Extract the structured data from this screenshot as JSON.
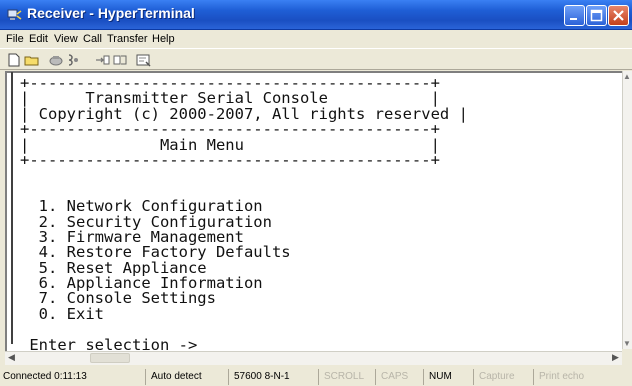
{
  "window": {
    "title": "Receiver - HyperTerminal"
  },
  "menu": [
    "File",
    "Edit",
    "View",
    "Call",
    "Transfer",
    "Help"
  ],
  "toolbar": {
    "icons": [
      "new-connection-icon",
      "open-icon",
      "call-icon",
      "disconnect-icon",
      "send-icon",
      "receive-icon",
      "properties-icon"
    ]
  },
  "terminal": {
    "lines": [
      "+-------------------------------------------+",
      "|      Transmitter Serial Console           |",
      "| Copyright (c) 2000-2007, All rights reserved |",
      "+-------------------------------------------+",
      "|              Main Menu                    |",
      "+-------------------------------------------+",
      "",
      "",
      "  1. Network Configuration",
      "  2. Security Configuration",
      "  3. Firmware Management",
      "  4. Restore Factory Defaults",
      "  5. Reset Appliance",
      "  6. Appliance Information",
      "  7. Console Settings",
      "  0. Exit",
      "",
      " Enter selection -> _"
    ]
  },
  "status": {
    "connected": "Connected 0:11:13",
    "detect": "Auto detect",
    "port": "57600 8-N-1",
    "scroll": "SCROLL",
    "caps": "CAPS",
    "num": "NUM",
    "capture": "Capture",
    "print_echo": "Print echo"
  }
}
